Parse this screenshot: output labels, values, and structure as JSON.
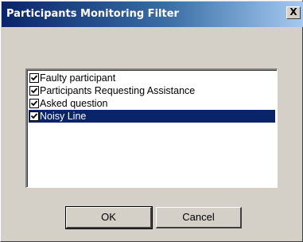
{
  "window": {
    "title": "Participants Monitoring Filter",
    "close_label": "X"
  },
  "list": {
    "items": [
      {
        "label": "Faulty participant",
        "checked": true,
        "selected": false
      },
      {
        "label": "Participants Requesting Assistance",
        "checked": true,
        "selected": false
      },
      {
        "label": "Asked question",
        "checked": true,
        "selected": false
      },
      {
        "label": "Noisy Line",
        "checked": true,
        "selected": true
      }
    ]
  },
  "buttons": {
    "ok_label": "OK",
    "cancel_label": "Cancel"
  },
  "colors": {
    "selection": "#0a246a",
    "title_start": "#0a246a",
    "title_end": "#a6caf0",
    "face": "#d4d0c8"
  }
}
